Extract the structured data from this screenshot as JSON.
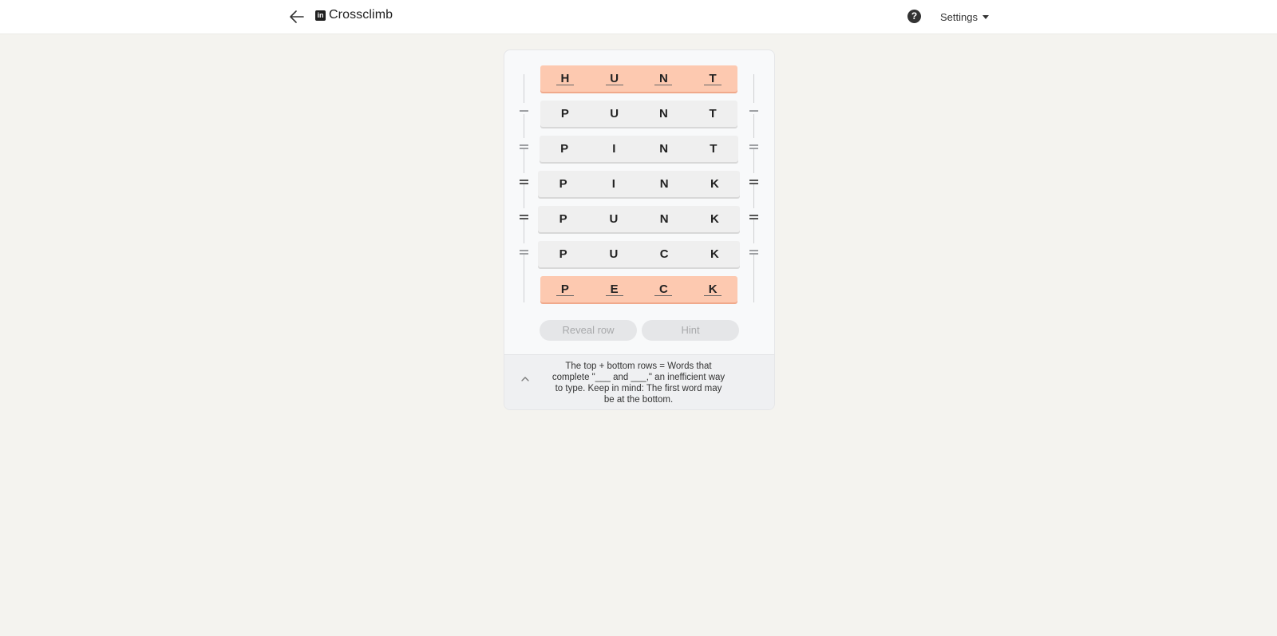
{
  "header": {
    "back_icon": "arrow-left-icon",
    "logo_icon": "linkedin-icon",
    "logo_text": "in",
    "title": "Crossclimb",
    "help_icon": "question-circle-icon",
    "help_glyph": "?",
    "settings_label": "Settings"
  },
  "puzzle": {
    "rows": [
      {
        "letters": [
          "H",
          "U",
          "N",
          "T"
        ],
        "locked": true
      },
      {
        "letters": [
          "P",
          "U",
          "N",
          "T"
        ],
        "locked": false
      },
      {
        "letters": [
          "P",
          "I",
          "N",
          "T"
        ],
        "locked": false
      },
      {
        "letters": [
          "P",
          "I",
          "N",
          "K"
        ],
        "locked": false
      },
      {
        "letters": [
          "P",
          "U",
          "N",
          "K"
        ],
        "locked": false
      },
      {
        "letters": [
          "P",
          "U",
          "C",
          "K"
        ],
        "locked": false
      },
      {
        "letters": [
          "P",
          "E",
          "C",
          "K"
        ],
        "locked": true
      }
    ]
  },
  "actions": {
    "reveal_label": "Reveal row",
    "hint_label": "Hint"
  },
  "clue": {
    "text": "The top + bottom rows = Words that complete \"___ and ___,\" an inefficient way to type. Keep in mind: The first word may be at the bottom."
  },
  "colors": {
    "locked_row": "#fdc9b0",
    "unlocked_row": "#efefef",
    "page_bg": "#f4f3ef"
  }
}
